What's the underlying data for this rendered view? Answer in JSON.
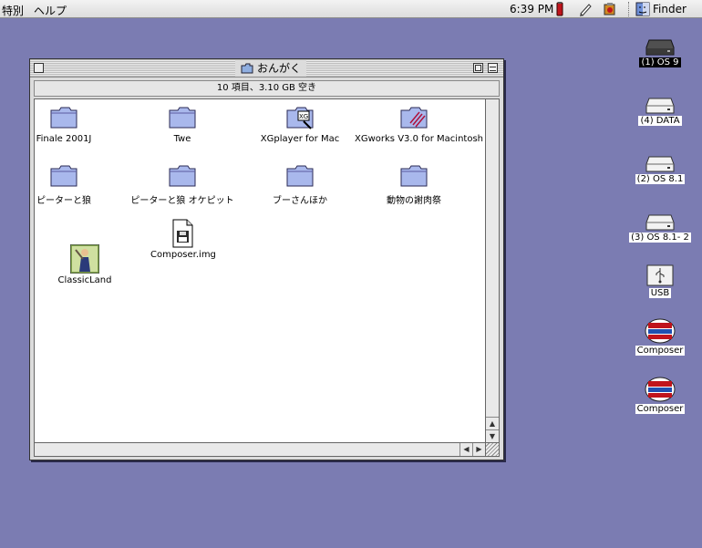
{
  "menubar": {
    "special": "特別",
    "help": "ヘルプ",
    "clock": "6:39 PM",
    "app": "Finder"
  },
  "window": {
    "title": "おんがく",
    "info": "10 項目、3.10 GB 空き",
    "items": [
      {
        "label": "Finale 2001J",
        "icon": "folder-icon"
      },
      {
        "label": "Twe",
        "icon": "folder-icon"
      },
      {
        "label": "XGplayer for Mac",
        "icon": "app-folder-icon"
      },
      {
        "label": "XGworks V3.0 for Macintosh",
        "icon": "app-folder-icon"
      },
      {
        "label": "ピーターと狼",
        "icon": "folder-icon"
      },
      {
        "label": "ピーターと狼 オケピット",
        "icon": "folder-icon"
      },
      {
        "label": "ブーさんほか",
        "icon": "folder-icon"
      },
      {
        "label": "動物の謝肉祭",
        "icon": "folder-icon"
      },
      {
        "label": "Composer.img",
        "icon": "disk-image-icon"
      },
      {
        "label": "ClassicLand",
        "icon": "classicland-app-icon"
      }
    ]
  },
  "desktop": {
    "items": [
      {
        "label": "(1) OS 9",
        "icon": "hard-disk-icon",
        "selected": true
      },
      {
        "label": "(4) DATA",
        "icon": "hard-disk-icon"
      },
      {
        "label": "(2) OS 8.1",
        "icon": "hard-disk-icon"
      },
      {
        "label": "(3) OS 8.1- 2",
        "icon": "hard-disk-icon"
      },
      {
        "label": "USB",
        "icon": "usb-drive-icon"
      },
      {
        "label": "Composer",
        "icon": "composer-volume-icon"
      },
      {
        "label": "Composer",
        "icon": "composer-volume-icon"
      }
    ]
  }
}
